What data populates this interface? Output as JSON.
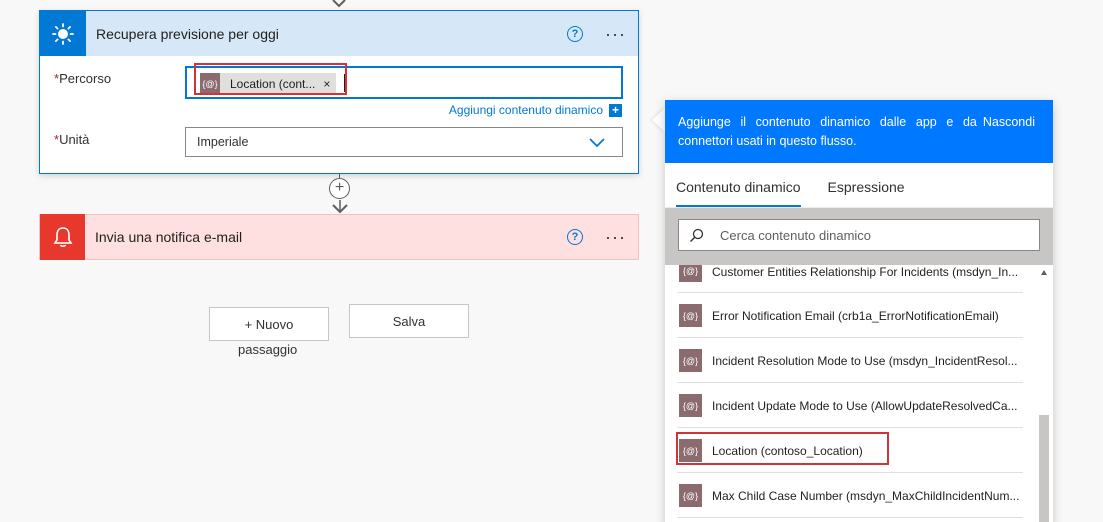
{
  "weather_card": {
    "title": "Recupera previsione per oggi",
    "help": "?",
    "more": "···",
    "path_label": "Percorso",
    "required_mark": "*",
    "token_icon": "{@}",
    "token_text": "Location (cont...",
    "token_close": "×",
    "add_dynamic": "Aggiungi contenuto dinamico",
    "add_plus": "+",
    "unit_label": "Unità",
    "unit_value": "Imperiale"
  },
  "connector": {
    "plus": "+"
  },
  "notify_card": {
    "title": "Invia una notifica e-mail",
    "help": "?",
    "more": "···"
  },
  "buttons": {
    "new_step_line1": "+ Nuovo",
    "new_step_line2": "passaggio",
    "save": "Salva"
  },
  "panel": {
    "info_text": "Aggiunge il contenuto dinamico dalle app e da connettori usati in questo flusso.",
    "hide_link": "Nascondi",
    "tabs": [
      "Contenuto dinamico",
      "Espressione"
    ],
    "search_placeholder": "Cerca contenuto dinamico",
    "item_icon": "{@}",
    "items": [
      "Customer Entities Relationship For Incidents (msdyn_In...",
      "Error Notification Email (crb1a_ErrorNotificationEmail)",
      "Incident Resolution Mode to Use (msdyn_IncidentResol...",
      "Incident Update Mode to Use (AllowUpdateResolvedCa...",
      "Location (contoso_Location)",
      "Max Child Case Number (msdyn_MaxChildIncidentNum..."
    ]
  },
  "colors": {
    "accent": "#0078d4",
    "notify": "#e8382e",
    "highlight": "#d13438",
    "info_bg": "#0078ff"
  }
}
